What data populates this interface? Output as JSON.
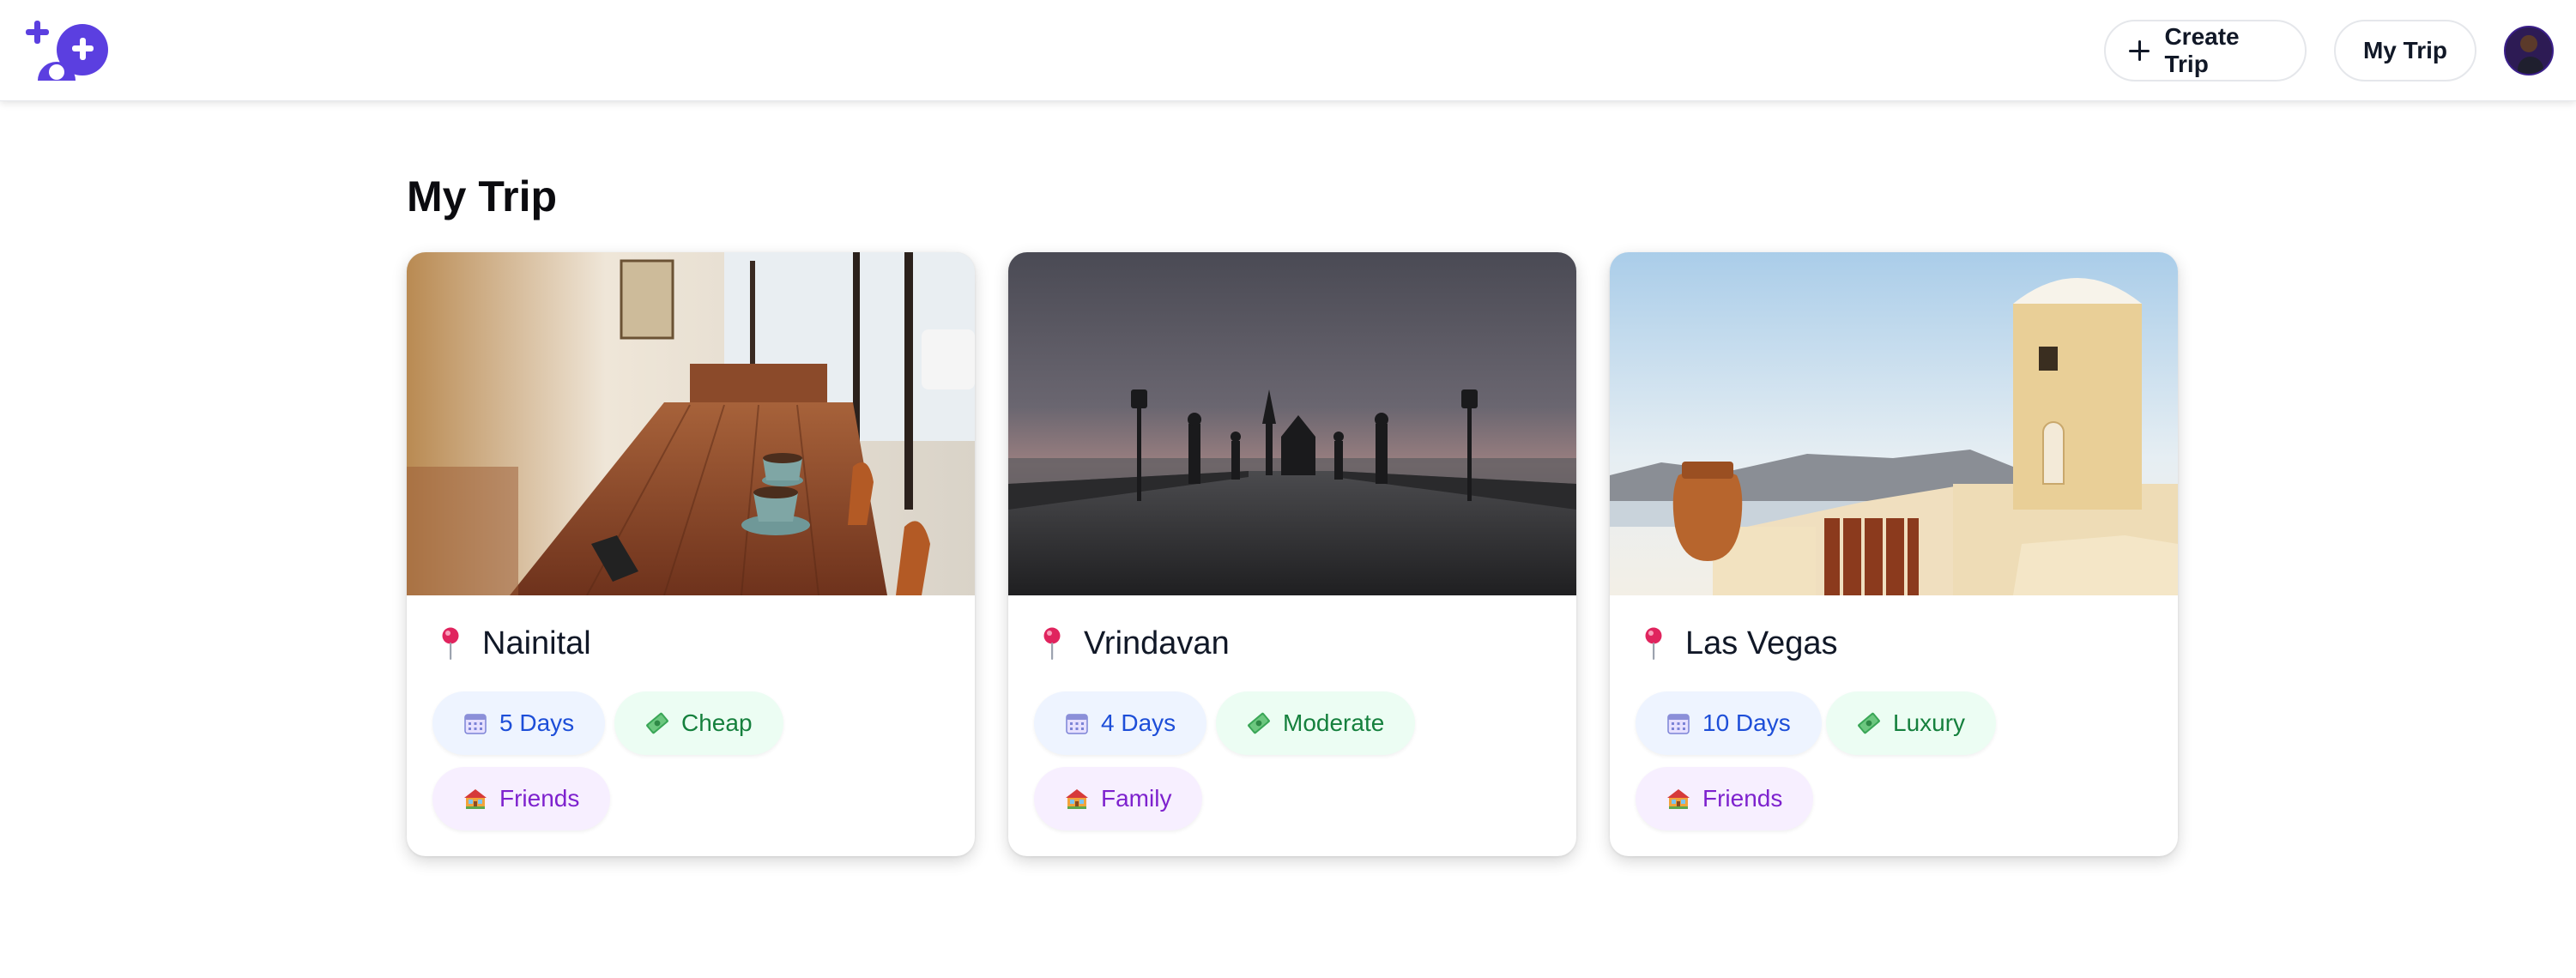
{
  "header": {
    "create_trip_label": "Create Trip",
    "my_trip_label": "My Trip"
  },
  "main": {
    "title": "My Trip",
    "trips": [
      {
        "destination": "Nainital",
        "days": "5 Days",
        "budget": "Cheap",
        "travelers": "Friends"
      },
      {
        "destination": "Vrindavan",
        "days": "4 Days",
        "budget": "Moderate",
        "travelers": "Family"
      },
      {
        "destination": "Las Vegas",
        "days": "10 Days",
        "budget": "Luxury",
        "travelers": "Friends"
      }
    ]
  },
  "icons": {
    "logo": "brand-logo-icon",
    "create": "plus-icon",
    "location": "pin-icon",
    "days": "calendar-icon",
    "budget": "money-icon",
    "travelers": "house-icon"
  },
  "colors": {
    "brand": "#5b3fe0",
    "days_text": "#1d4ed8",
    "budget_text": "#15803d",
    "travelers_text": "#7e22ce"
  }
}
